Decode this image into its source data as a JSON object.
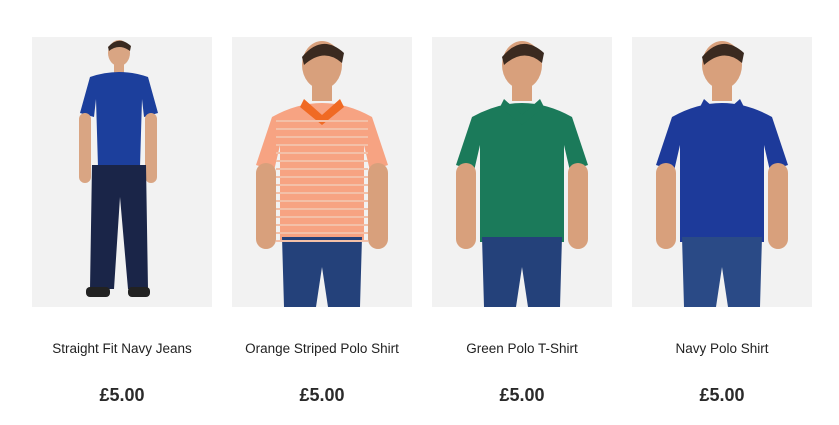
{
  "products": [
    {
      "name": "Straight Fit Navy Jeans",
      "price": "£5.00",
      "image_icon": "model-photo-navy-polo-jeans",
      "colors": {
        "shirt": "#1c3f9c",
        "collar": "#1c3f9c",
        "pants": "#1a2548",
        "skin": "#d9a583"
      }
    },
    {
      "name": "Orange Striped Polo Shirt",
      "price": "£5.00",
      "image_icon": "model-photo-orange-striped-polo",
      "colors": {
        "shirt": "#f7a382",
        "collar": "#f06a24",
        "pants": "#24417a",
        "skin": "#d8a07c"
      }
    },
    {
      "name": "Green Polo T-Shirt",
      "price": "£5.00",
      "image_icon": "model-photo-green-polo",
      "colors": {
        "shirt": "#1b7a5a",
        "collar": "#1b7a5a",
        "pants": "#24417a",
        "skin": "#d8a07c"
      }
    },
    {
      "name": "Navy Polo Shirt",
      "price": "£5.00",
      "image_icon": "model-photo-navy-polo",
      "colors": {
        "shirt": "#1d3a9a",
        "collar": "#1d3a9a",
        "pants": "#2a4a86",
        "skin": "#d8a07c"
      }
    }
  ]
}
